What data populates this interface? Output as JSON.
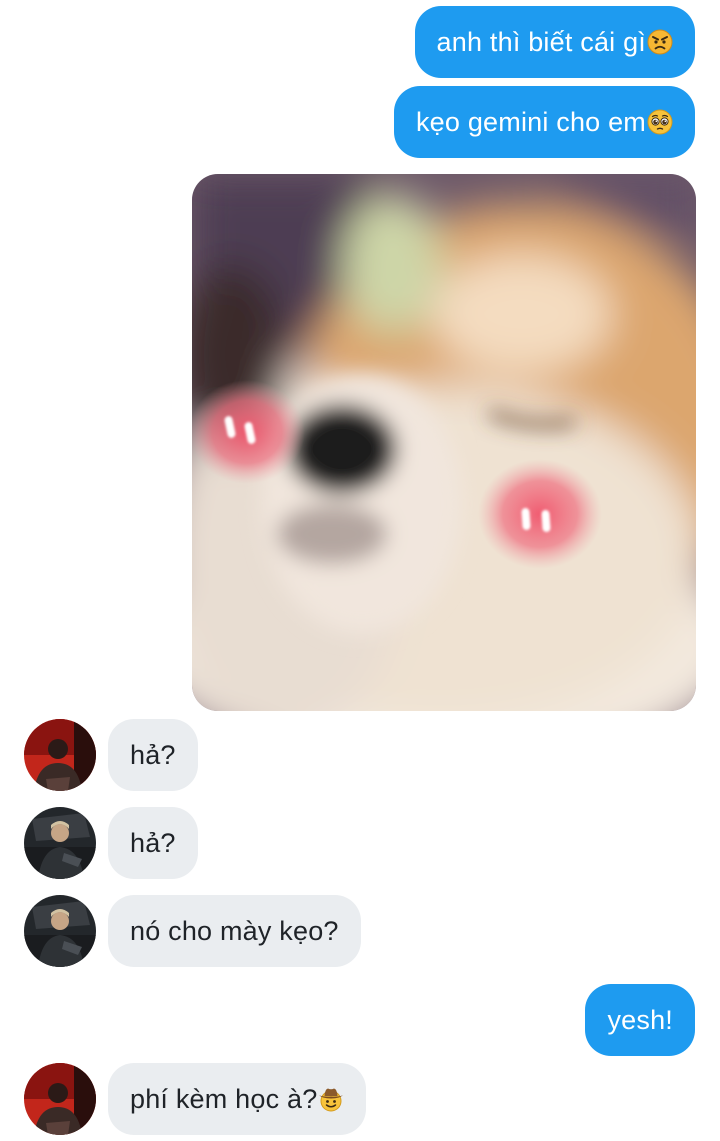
{
  "messages": [
    {
      "side": "out",
      "text": "anh thì biết cái gì",
      "emoji": "angry-face-icon"
    },
    {
      "side": "out",
      "text": "kẹo gemini cho em",
      "emoji": "pleading-face-icon"
    },
    {
      "side": "out",
      "type": "image",
      "image": "blushing-shiba-dog-photo"
    },
    {
      "side": "in",
      "sender": "contact-red",
      "text": "hả?"
    },
    {
      "side": "in",
      "sender": "contact-dark",
      "text": "hả?"
    },
    {
      "side": "in",
      "sender": "contact-dark",
      "text": "nó cho mày kẹo?"
    },
    {
      "side": "out",
      "text": "yesh!"
    },
    {
      "side": "in",
      "sender": "contact-red",
      "text": "phí kèm học à?",
      "emoji": "cowboy-face-icon"
    }
  ],
  "colors": {
    "outgoing_bubble": "#1e9bf0",
    "incoming_bubble": "#eaedf0",
    "outgoing_text": "#ffffff",
    "incoming_text": "#1f2328"
  }
}
